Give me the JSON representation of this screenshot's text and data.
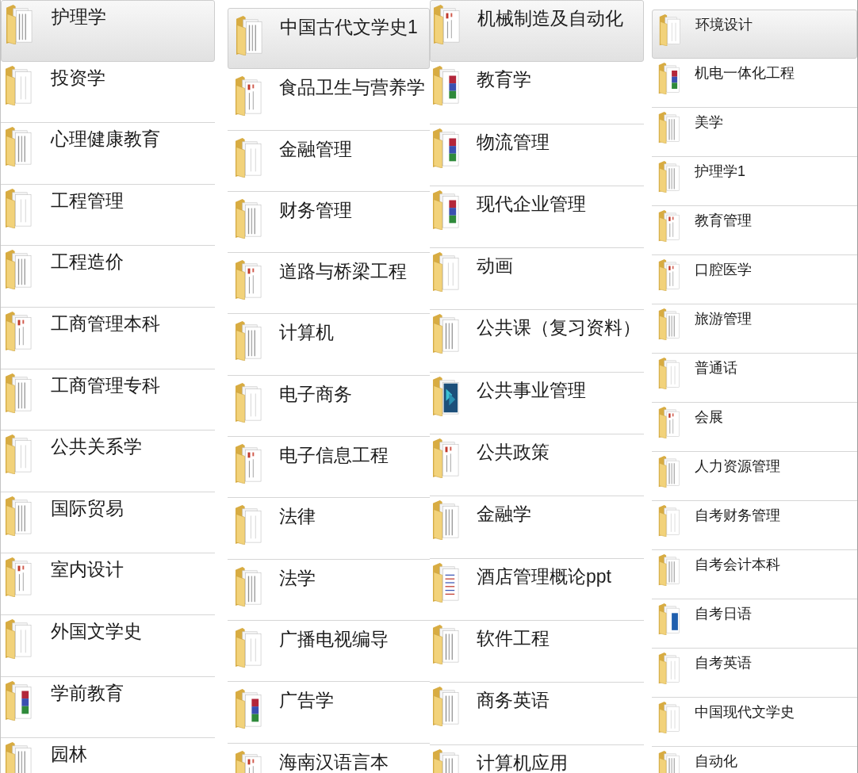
{
  "columns": [
    {
      "items": [
        {
          "name": "护理学",
          "kind": "striped",
          "selected": true
        },
        {
          "name": "投资学",
          "kind": "plain",
          "selected": false
        },
        {
          "name": "心理健康教育",
          "kind": "striped",
          "selected": false
        },
        {
          "name": "工程管理",
          "kind": "plain",
          "selected": false
        },
        {
          "name": "工程造价",
          "kind": "striped",
          "selected": false
        },
        {
          "name": "工商管理本科",
          "kind": "red",
          "selected": false
        },
        {
          "name": "工商管理专科",
          "kind": "striped",
          "selected": false
        },
        {
          "name": "公共关系学",
          "kind": "plain",
          "selected": false
        },
        {
          "name": "国际贸易",
          "kind": "striped",
          "selected": false
        },
        {
          "name": "室内设计",
          "kind": "red",
          "selected": false
        },
        {
          "name": "外国文学史",
          "kind": "plain",
          "selected": false
        },
        {
          "name": "学前教育",
          "kind": "colorful",
          "selected": false
        },
        {
          "name": "园林",
          "kind": "striped",
          "selected": false
        }
      ]
    },
    {
      "items": [
        {
          "name": "中国古代文学史1",
          "kind": "striped",
          "selected": true
        },
        {
          "name": "食品卫生与营养学",
          "kind": "red",
          "selected": false
        },
        {
          "name": "金融管理",
          "kind": "plain",
          "selected": false
        },
        {
          "name": "财务管理",
          "kind": "striped",
          "selected": false
        },
        {
          "name": "道路与桥梁工程",
          "kind": "red",
          "selected": false
        },
        {
          "name": "计算机",
          "kind": "striped",
          "selected": false
        },
        {
          "name": "电子商务",
          "kind": "plain",
          "selected": false
        },
        {
          "name": "电子信息工程",
          "kind": "red",
          "selected": false
        },
        {
          "name": "法律",
          "kind": "plain",
          "selected": false
        },
        {
          "name": "法学",
          "kind": "striped",
          "selected": false
        },
        {
          "name": "广播电视编导",
          "kind": "plain",
          "selected": false
        },
        {
          "name": "广告学",
          "kind": "colorful",
          "selected": false
        },
        {
          "name": "海南汉语言本",
          "kind": "red",
          "selected": false
        }
      ]
    },
    {
      "items": [
        {
          "name": "机械制造及自动化",
          "kind": "red",
          "selected": true
        },
        {
          "name": "教育学",
          "kind": "colorful",
          "selected": false
        },
        {
          "name": "物流管理",
          "kind": "colorful",
          "selected": false
        },
        {
          "name": "现代企业管理",
          "kind": "colorful",
          "selected": false
        },
        {
          "name": "动画",
          "kind": "plain",
          "selected": false
        },
        {
          "name": "公共课（复习资料）",
          "kind": "striped",
          "selected": false
        },
        {
          "name": "公共事业管理",
          "kind": "teal",
          "selected": false
        },
        {
          "name": "公共政策",
          "kind": "red",
          "selected": false
        },
        {
          "name": "金融学",
          "kind": "striped",
          "selected": false
        },
        {
          "name": "酒店管理概论ppt",
          "kind": "list",
          "selected": false
        },
        {
          "name": "软件工程",
          "kind": "striped",
          "selected": false
        },
        {
          "name": "商务英语",
          "kind": "striped",
          "selected": false
        },
        {
          "name": "计算机应用",
          "kind": "striped",
          "selected": false
        }
      ]
    },
    {
      "items": [
        {
          "name": "环境设计",
          "kind": "plain",
          "selected": true
        },
        {
          "name": "机电一体化工程",
          "kind": "colorful",
          "selected": false
        },
        {
          "name": "美学",
          "kind": "striped",
          "selected": false
        },
        {
          "name": "护理学1",
          "kind": "striped",
          "selected": false
        },
        {
          "name": "教育管理",
          "kind": "red",
          "selected": false
        },
        {
          "name": "口腔医学",
          "kind": "red",
          "selected": false
        },
        {
          "name": "旅游管理",
          "kind": "striped",
          "selected": false
        },
        {
          "name": "普通话",
          "kind": "plain",
          "selected": false
        },
        {
          "name": "会展",
          "kind": "red",
          "selected": false
        },
        {
          "name": "人力资源管理",
          "kind": "striped",
          "selected": false
        },
        {
          "name": "自考财务管理",
          "kind": "plain",
          "selected": false
        },
        {
          "name": "自考会计本科",
          "kind": "striped",
          "selected": false
        },
        {
          "name": "自考日语",
          "kind": "blue",
          "selected": false
        },
        {
          "name": "自考英语",
          "kind": "plain",
          "selected": false
        },
        {
          "name": "中国现代文学史",
          "kind": "plain",
          "selected": false
        },
        {
          "name": "自动化",
          "kind": "striped",
          "selected": false
        }
      ]
    }
  ]
}
